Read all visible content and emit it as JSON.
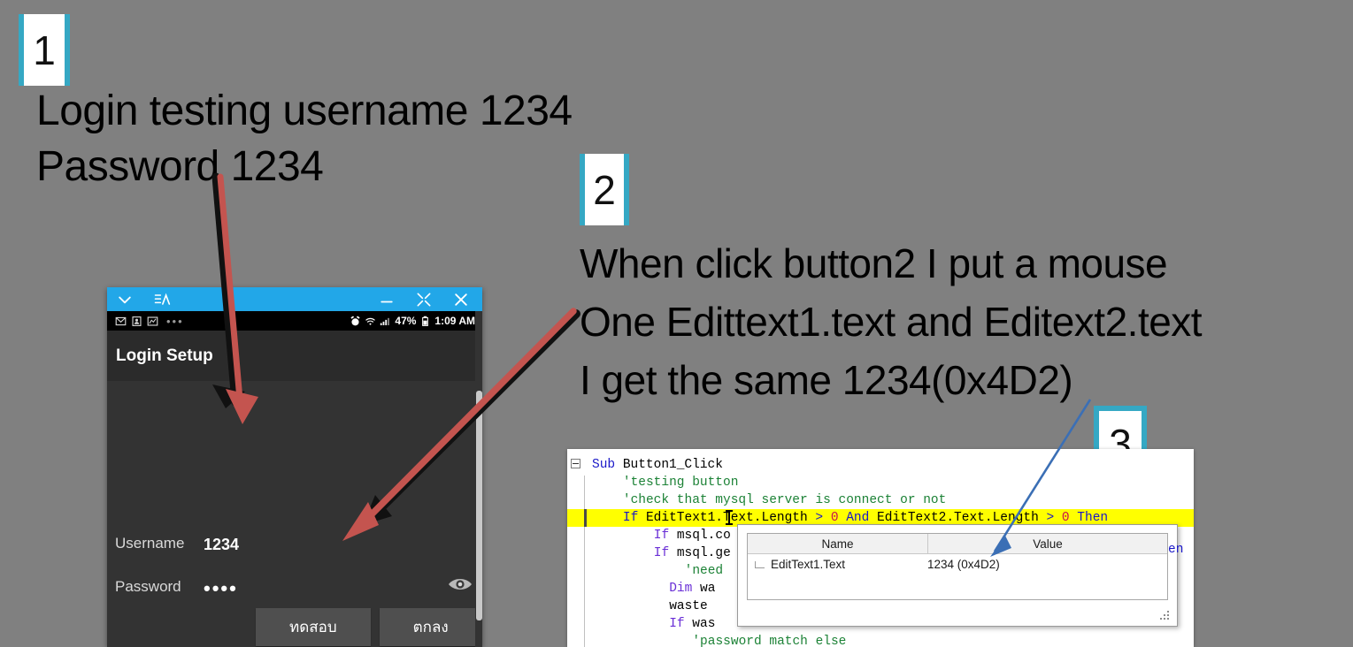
{
  "background_color": "#808080",
  "accent_color": "#35a8c4",
  "callouts": [
    {
      "number": "1"
    },
    {
      "number": "2"
    },
    {
      "number": "3"
    }
  ],
  "annotations": {
    "left": [
      "Login testing username 1234",
      "Password 1234"
    ],
    "right": [
      "When click button2 I put a mouse",
      "One Edittext1.text and Editext2.text",
      "I get the same 1234(0x4D2)"
    ]
  },
  "emulator": {
    "titlebar": {
      "icons_left": [
        "chevron-down-icon",
        "text-lines-icon"
      ],
      "icons_right": [
        "minimize-icon",
        "maximize-icon",
        "close-icon"
      ],
      "background": "#22a7e8"
    },
    "statusbar": {
      "notification_icons": [
        "mail-icon",
        "contact-icon",
        "chart-icon"
      ],
      "overflow": "•••",
      "system_icons": [
        "alarm-icon",
        "wifi-icon",
        "signal-icon"
      ],
      "battery_percent": "47%",
      "time": "1:09 AM"
    },
    "action_bar": {
      "title": "Login Setup"
    },
    "form": {
      "fields": [
        {
          "label": "Username",
          "value": "1234",
          "masked": false,
          "focused": true
        },
        {
          "label": "Password",
          "value": "••••",
          "masked": true,
          "focused": false,
          "trailing_icon": "eye-icon"
        }
      ],
      "buttons": [
        {
          "label": "ทดสอบ"
        },
        {
          "label": "ตกลง"
        }
      ]
    }
  },
  "code_panel": {
    "lines": [
      {
        "indent": 0,
        "segments": [
          {
            "t": "Sub ",
            "c": "kw"
          },
          {
            "t": "Button1_Click",
            "c": "id"
          }
        ]
      },
      {
        "indent": 4,
        "segments": [
          {
            "t": "'testing button",
            "c": "cm"
          }
        ]
      },
      {
        "indent": 4,
        "segments": [
          {
            "t": "'check that mysql server is connect or not",
            "c": "cm"
          }
        ]
      },
      {
        "indent": 4,
        "highlight": true,
        "segments": [
          {
            "t": "If ",
            "c": "kw"
          },
          {
            "t": "EditText1.Text.Length ",
            "c": "id"
          },
          {
            "t": "> ",
            "c": "kw"
          },
          {
            "t": "0",
            "c": "num"
          },
          {
            "t": " And ",
            "c": "kw"
          },
          {
            "t": "EditText2.Text.Length ",
            "c": "id"
          },
          {
            "t": "> ",
            "c": "kw"
          },
          {
            "t": "0",
            "c": "num"
          },
          {
            "t": " Then",
            "c": "kw"
          }
        ]
      },
      {
        "indent": 8,
        "segments": [
          {
            "t": "If ",
            "c": "kw2"
          },
          {
            "t": "msql.co",
            "c": "id"
          }
        ]
      },
      {
        "indent": 8,
        "segments": [
          {
            "t": "If ",
            "c": "kw2"
          },
          {
            "t": "msql.ge",
            "c": "id"
          }
        ]
      },
      {
        "indent": 12,
        "segments": [
          {
            "t": "'need",
            "c": "cm"
          }
        ]
      },
      {
        "indent": 10,
        "segments": [
          {
            "t": "Dim ",
            "c": "kw2"
          },
          {
            "t": "wa",
            "c": "id"
          }
        ]
      },
      {
        "indent": 10,
        "segments": [
          {
            "t": "waste",
            "c": "id"
          }
        ]
      },
      {
        "indent": 10,
        "segments": [
          {
            "t": "If ",
            "c": "kw2"
          },
          {
            "t": "was",
            "c": "id"
          }
        ]
      },
      {
        "indent": 13,
        "segments": [
          {
            "t": "'password match else",
            "c": "cm"
          }
        ]
      }
    ],
    "right_fragment": "en"
  },
  "watch_panel": {
    "columns": [
      "Name",
      "Value"
    ],
    "rows": [
      {
        "name": "EditText1.Text",
        "value": "1234 (0x4D2)"
      }
    ]
  },
  "arrows": [
    {
      "name": "red-arrow-to-username",
      "color": "#c4544f"
    },
    {
      "name": "red-arrow-to-test-button",
      "color": "#c4544f"
    },
    {
      "name": "blue-arrow-to-watch-value",
      "color": "#3b6fb5"
    }
  ]
}
